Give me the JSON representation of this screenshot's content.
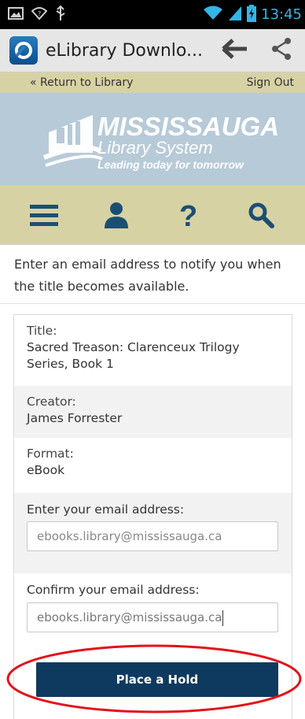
{
  "status_bar": {
    "time": "13:45",
    "icons": [
      "image-icon",
      "wifi-icon",
      "usb-icon",
      "signal-icon",
      "battery-icon"
    ],
    "accent": "#33b5e5"
  },
  "action_bar": {
    "title": "eLibrary Downlo...",
    "icons": [
      "app-logo-icon",
      "back-arrow-icon",
      "share-icon"
    ]
  },
  "header": {
    "return_link": "« Return to Library",
    "sign_out": "Sign Out",
    "logo_title": "MISSISSAUGA",
    "logo_subtitle": "Library System",
    "logo_tagline": "Leading today for tomorrow",
    "nav_icons": [
      "menu-icon",
      "user-icon",
      "help-icon",
      "search-icon"
    ],
    "banner_color": "#b7cad8",
    "strip_color": "#d7d2a4",
    "nav_icon_color": "#1b4f72"
  },
  "intro_text": "Enter an email address to notify you when the title becomes available.",
  "details": {
    "title_label": "Title:",
    "title_value": "Sacred Treason: Clarenceux Trilogy Series, Book 1",
    "creator_label": "Creator:",
    "creator_value": "James Forrester",
    "format_label": "Format:",
    "format_value": "eBook"
  },
  "form": {
    "email_label": "Enter your email address:",
    "email_value": "ebooks.library@mississauga.ca",
    "confirm_label": "Confirm your email address:",
    "confirm_value": "ebooks.library@mississauga.ca",
    "submit_label": "Place a Hold",
    "button_color": "#0f3a5f",
    "highlight_color": "#e0141b"
  }
}
